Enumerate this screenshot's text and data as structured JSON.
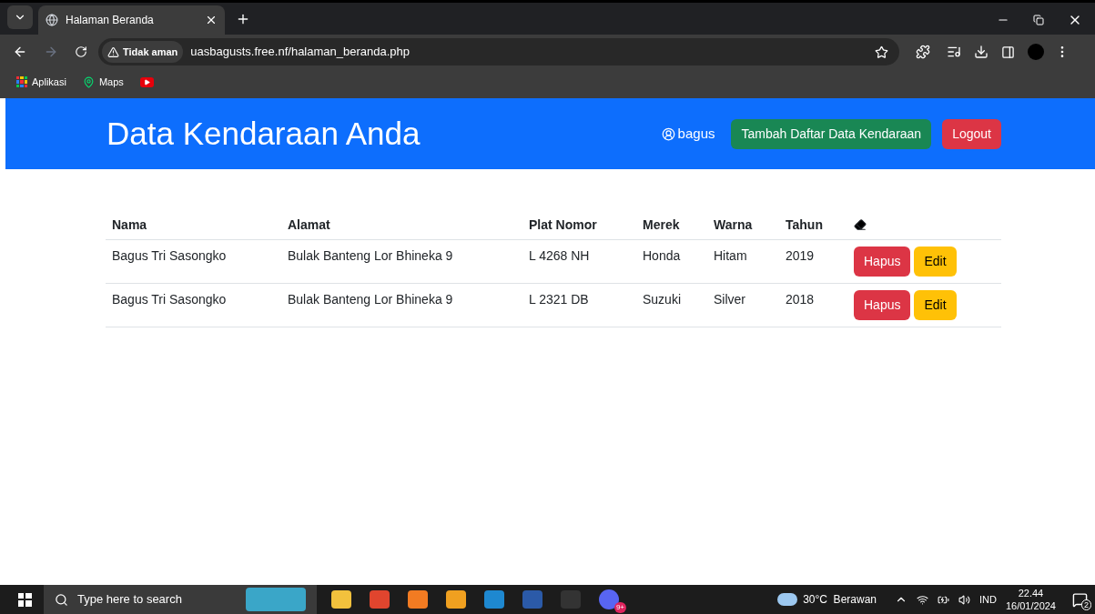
{
  "browser": {
    "tab_title": "Halaman Beranda",
    "security": "Tidak aman",
    "url": "uasbagusts.free.nf/halaman_beranda.php",
    "bookmarks": [
      "Aplikasi",
      "Maps"
    ]
  },
  "header": {
    "title": "Data Kendaraan Anda",
    "user": "bagus",
    "add_button": "Tambah Daftar Data Kendaraan",
    "logout_button": "Logout"
  },
  "table": {
    "columns": [
      "Nama",
      "Alamat",
      "Plat Nomor",
      "Merek",
      "Warna",
      "Tahun"
    ],
    "rows": [
      {
        "cells": [
          "Bagus Tri Sasongko",
          "Bulak Banteng Lor Bhineka 9",
          "L 4268 NH",
          "Honda",
          "Hitam",
          "2019"
        ],
        "actions": [
          "Hapus",
          "Edit"
        ]
      },
      {
        "cells": [
          "Bagus Tri Sasongko",
          "Bulak Banteng Lor Bhineka 9",
          "L 2321 DB",
          "Suzuki",
          "Silver",
          "2018"
        ],
        "actions": [
          "Hapus",
          "Edit"
        ]
      }
    ]
  },
  "taskbar": {
    "search_placeholder": "Type here to search",
    "badge": "9+",
    "weather": "30°C  Berawan",
    "language": "IND",
    "time": "22.44",
    "date": "16/01/2024",
    "notifications": "2"
  }
}
